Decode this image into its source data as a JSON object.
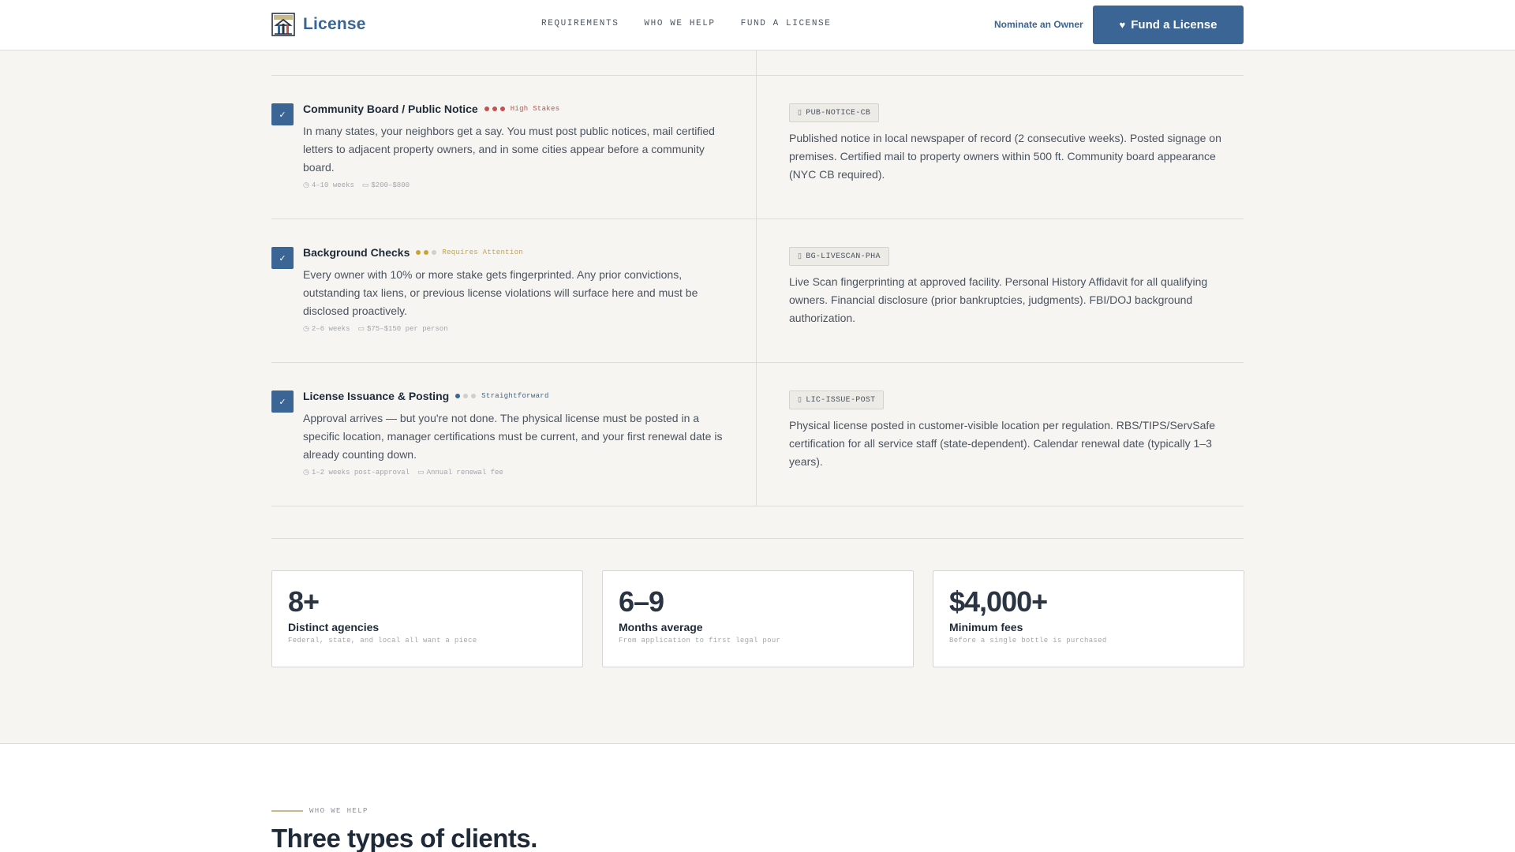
{
  "header": {
    "brand": "License",
    "nav": [
      "REQUIREMENTS",
      "WHO WE HELP",
      "FUND A LICENSE"
    ],
    "nominate_label": "Nominate an Owner",
    "fund_button_label": "Fund a License"
  },
  "steps": [
    {
      "title": "Community Board / Public Notice",
      "level": "High Stakes",
      "level_color": "#c0534f",
      "dots_filled": 3,
      "description": "In many states, your neighbors get a say. You must post public notices, mail certified letters to adjacent property owners, and in some cities appear before a community board.",
      "time": "4–10 weeks",
      "cost": "$200–$800",
      "code": "PUB-NOTICE-CB",
      "detail": "Published notice in local newspaper of record (2 consecutive weeks). Posted signage on premises. Certified mail to property owners within 500 ft. Community board appearance (NYC CB required)."
    },
    {
      "title": "Background Checks",
      "level": "Requires Attention",
      "level_color": "#c9a23a",
      "dots_filled": 2,
      "description": "Every owner with 10% or more stake gets fingerprinted. Any prior convictions, outstanding tax liens, or previous license violations will surface here and must be disclosed proactively.",
      "time": "2–6 weeks",
      "cost": "$75–$150 per person",
      "code": "BG-LIVESCAN-PHA",
      "detail": "Live Scan fingerprinting at approved facility. Personal History Affidavit for all qualifying owners. Financial disclosure (prior bankruptcies, judgments). FBI/DOJ background authorization."
    },
    {
      "title": "License Issuance & Posting",
      "level": "Straightforward",
      "level_color": "#3a6594",
      "dots_filled": 1,
      "description": "Approval arrives — but you're not done. The physical license must be posted in a specific location, manager certifications must be current, and your first renewal date is already counting down.",
      "time": "1–2 weeks post-approval",
      "cost": "Annual renewal fee",
      "code": "LIC-ISSUE-POST",
      "detail": "Physical license posted in customer-visible location per regulation. RBS/TIPS/ServSafe certification for all service staff (state-dependent). Calendar renewal date (typically 1–3 years)."
    }
  ],
  "stats": [
    {
      "value": "8+",
      "label": "Distinct agencies",
      "sub": "Federal, state, and local all want a piece"
    },
    {
      "value": "6–9",
      "label": "Months average",
      "sub": "From application to first legal pour"
    },
    {
      "value": "$4,000+",
      "label": "Minimum fees",
      "sub": "Before a single bottle is purchased"
    }
  ],
  "who_we_help": {
    "kicker": "WHO WE HELP",
    "title": "Three types of clients."
  },
  "icons": {
    "check": "check-icon",
    "heart": "heart-icon",
    "clock": "clock-icon",
    "money": "money-icon",
    "document": "document-icon",
    "logo": "storefront-logo-icon"
  },
  "colors": {
    "accent": "#3a6594",
    "high": "#c0534f",
    "medium": "#c9a23a",
    "low": "#3a6594",
    "background": "#f6f5f1"
  }
}
